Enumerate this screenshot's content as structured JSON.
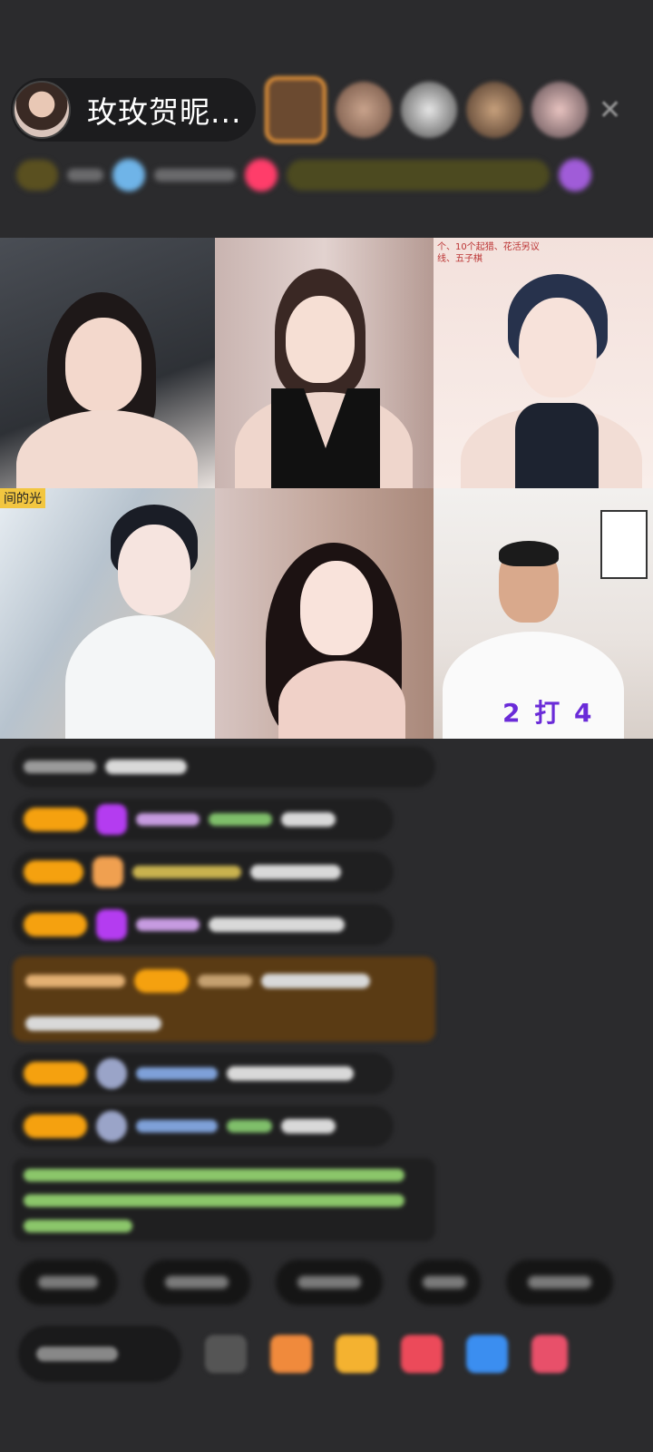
{
  "header": {
    "host_name": "玫玫贺昵...",
    "close_icon": "close-icon"
  },
  "video_grid": {
    "cells": [
      {
        "caption": ""
      },
      {
        "caption": ""
      },
      {
        "caption": "个、10个起猎、花活另议\n线、五子棋"
      },
      {
        "caption": "间的光"
      },
      {
        "caption": ""
      },
      {
        "caption": "2 打 4"
      }
    ]
  },
  "colors": {
    "background": "#2b2b2d",
    "badge": "#f5a10f",
    "highlight_comment": "#5a3b14",
    "duo_text": "#6a2bd8"
  }
}
